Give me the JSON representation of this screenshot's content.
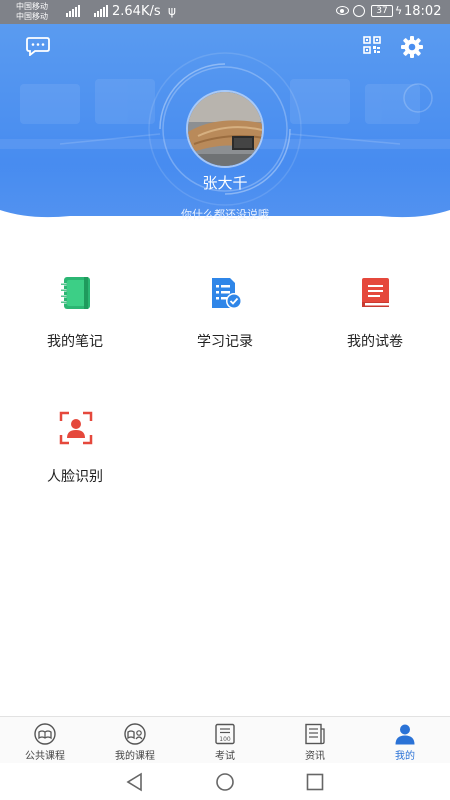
{
  "status_bar": {
    "carrier_1": "中国移动",
    "carrier_2": "中国移动",
    "network_speed": "2.64K/s",
    "battery": "37",
    "time": "18:02"
  },
  "profile": {
    "name": "张大千",
    "signature": "你什么都还没说哦"
  },
  "menu": [
    {
      "label": "我的笔记",
      "icon": "notebook-icon",
      "color": "#2bb673"
    },
    {
      "label": "学习记录",
      "icon": "study-record-icon",
      "color": "#2f86e8"
    },
    {
      "label": "我的试卷",
      "icon": "exam-paper-icon",
      "color": "#e5483c"
    },
    {
      "label": "人脸识别",
      "icon": "face-recognition-icon",
      "color": "#e5483c"
    }
  ],
  "tabs": [
    {
      "label": "公共课程",
      "icon": "public-course-icon"
    },
    {
      "label": "我的课程",
      "icon": "my-course-icon"
    },
    {
      "label": "考试",
      "icon": "exam-icon"
    },
    {
      "label": "资讯",
      "icon": "news-icon"
    },
    {
      "label": "我的",
      "icon": "user-icon",
      "active": true
    }
  ],
  "colors": {
    "header": "#4a8ef0",
    "active_tab": "#2a72d6"
  }
}
